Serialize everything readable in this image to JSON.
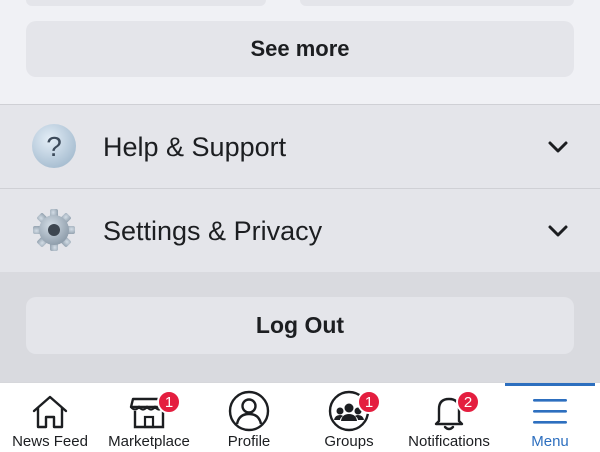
{
  "menu": {
    "see_more_label": "See more",
    "sections": [
      {
        "label": "Help & Support",
        "icon": "help-icon"
      },
      {
        "label": "Settings & Privacy",
        "icon": "gear-icon"
      }
    ],
    "logout_label": "Log Out"
  },
  "tab_bar": {
    "tabs": [
      {
        "label": "News Feed",
        "icon": "home-icon"
      },
      {
        "label": "Marketplace",
        "icon": "storefront-icon",
        "badge": "1"
      },
      {
        "label": "Profile",
        "icon": "profile-icon"
      },
      {
        "label": "Groups",
        "icon": "groups-icon",
        "badge": "1"
      },
      {
        "label": "Notifications",
        "icon": "bell-icon",
        "badge": "2"
      },
      {
        "label": "Menu",
        "icon": "menu-icon",
        "active": true
      }
    ]
  },
  "colors": {
    "accent": "#2d6fbf",
    "badge": "#e41e3f",
    "text": "#1c1e21"
  }
}
